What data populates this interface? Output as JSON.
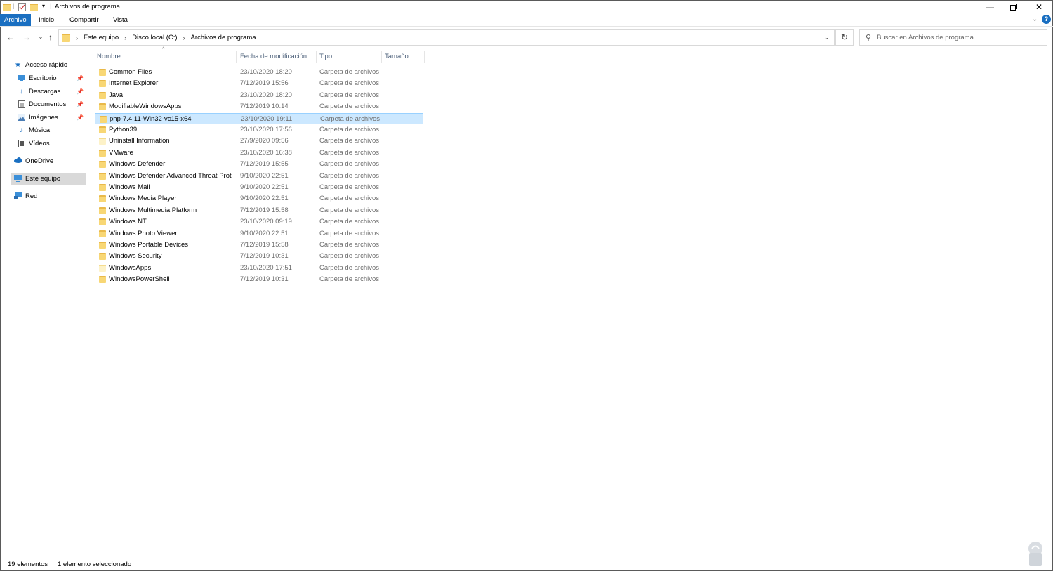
{
  "window": {
    "title": "Archivos de programa",
    "minimize_icon": "minimize-icon",
    "maximize_icon": "restore-icon",
    "close_icon": "close-icon"
  },
  "ribbon": {
    "tabs": [
      {
        "label": "Archivo",
        "active": true
      },
      {
        "label": "Inicio",
        "active": false
      },
      {
        "label": "Compartir",
        "active": false
      },
      {
        "label": "Vista",
        "active": false
      }
    ],
    "help_label": "?"
  },
  "address": {
    "crumbs": [
      "Este equipo",
      "Disco local (C:)",
      "Archivos de programa"
    ]
  },
  "search": {
    "placeholder": "Buscar en Archivos de programa"
  },
  "sidebar": {
    "items": [
      {
        "label": "Acceso rápido",
        "icon": "star-icon",
        "pinned": false
      },
      {
        "label": "Escritorio",
        "icon": "desktop-icon",
        "pinned": true
      },
      {
        "label": "Descargas",
        "icon": "download-icon",
        "pinned": true
      },
      {
        "label": "Documentos",
        "icon": "documents-icon",
        "pinned": true
      },
      {
        "label": "Imágenes",
        "icon": "pictures-icon",
        "pinned": true
      },
      {
        "label": "Música",
        "icon": "music-icon",
        "pinned": false
      },
      {
        "label": "Vídeos",
        "icon": "videos-icon",
        "pinned": false
      },
      {
        "label": "OneDrive",
        "icon": "cloud-icon",
        "pinned": false
      },
      {
        "label": "Este equipo",
        "icon": "computer-icon",
        "pinned": false,
        "selected": true
      },
      {
        "label": "Red",
        "icon": "network-icon",
        "pinned": false
      }
    ]
  },
  "columns": [
    "Nombre",
    "Fecha de modificación",
    "Tipo",
    "Tamaño"
  ],
  "files": [
    {
      "name": "Common Files",
      "date": "23/10/2020 18:20",
      "type": "Carpeta de archivos"
    },
    {
      "name": "Internet Explorer",
      "date": "7/12/2019 15:56",
      "type": "Carpeta de archivos"
    },
    {
      "name": "Java",
      "date": "23/10/2020 18:20",
      "type": "Carpeta de archivos"
    },
    {
      "name": "ModifiableWindowsApps",
      "date": "7/12/2019 10:14",
      "type": "Carpeta de archivos"
    },
    {
      "name": "php-7.4.11-Win32-vc15-x64",
      "date": "23/10/2020 19:11",
      "type": "Carpeta de archivos",
      "selected": true
    },
    {
      "name": "Python39",
      "date": "23/10/2020 17:56",
      "type": "Carpeta de archivos"
    },
    {
      "name": "Uninstall Information",
      "date": "27/9/2020 09:56",
      "type": "Carpeta de archivos",
      "pale": true
    },
    {
      "name": "VMware",
      "date": "23/10/2020 16:38",
      "type": "Carpeta de archivos"
    },
    {
      "name": "Windows Defender",
      "date": "7/12/2019 15:55",
      "type": "Carpeta de archivos"
    },
    {
      "name": "Windows Defender Advanced Threat Prot...",
      "date": "9/10/2020 22:51",
      "type": "Carpeta de archivos"
    },
    {
      "name": "Windows Mail",
      "date": "9/10/2020 22:51",
      "type": "Carpeta de archivos"
    },
    {
      "name": "Windows Media Player",
      "date": "9/10/2020 22:51",
      "type": "Carpeta de archivos"
    },
    {
      "name": "Windows Multimedia Platform",
      "date": "7/12/2019 15:58",
      "type": "Carpeta de archivos"
    },
    {
      "name": "Windows NT",
      "date": "23/10/2020 09:19",
      "type": "Carpeta de archivos"
    },
    {
      "name": "Windows Photo Viewer",
      "date": "9/10/2020 22:51",
      "type": "Carpeta de archivos"
    },
    {
      "name": "Windows Portable Devices",
      "date": "7/12/2019 15:58",
      "type": "Carpeta de archivos"
    },
    {
      "name": "Windows Security",
      "date": "7/12/2019 10:31",
      "type": "Carpeta de archivos"
    },
    {
      "name": "WindowsApps",
      "date": "23/10/2020 17:51",
      "type": "Carpeta de archivos",
      "pale": true
    },
    {
      "name": "WindowsPowerShell",
      "date": "7/12/2019 10:31",
      "type": "Carpeta de archivos"
    }
  ],
  "status": {
    "count": "19 elementos",
    "selected": "1 elemento seleccionado"
  },
  "colors": {
    "accent": "#1a6fc1",
    "selection": "#cce8ff",
    "selection_border": "#99d1ff"
  }
}
